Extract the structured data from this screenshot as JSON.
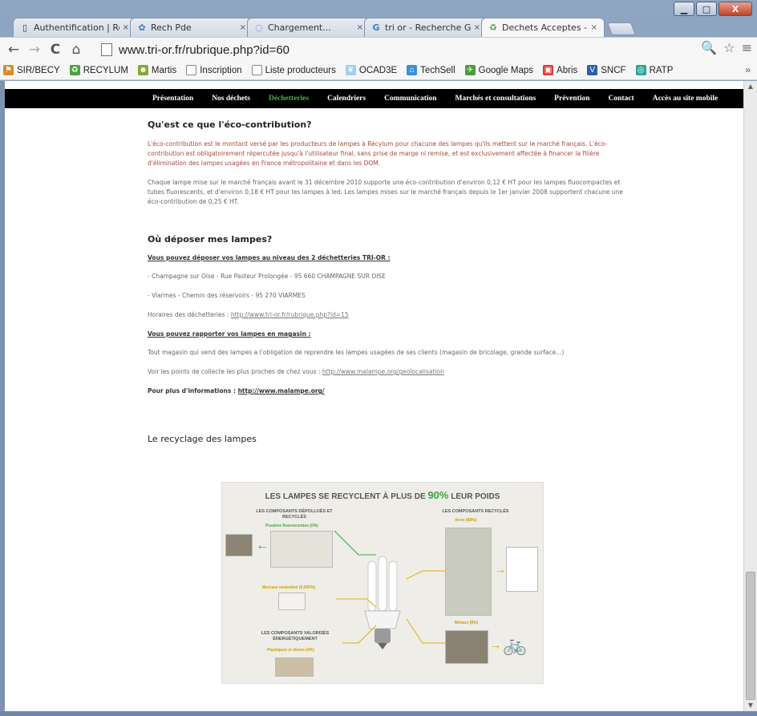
{
  "window": {
    "minimize": "▁",
    "maximize": "□",
    "close": "X"
  },
  "tabs": [
    {
      "label": "Authentification | Rec",
      "icon": "page-icon",
      "close": "×"
    },
    {
      "label": "Rech Pde",
      "icon": "gear-icon",
      "close": "×"
    },
    {
      "label": "Chargement...",
      "icon": "loading-icon",
      "close": "×"
    },
    {
      "label": "tri or - Recherche Go",
      "icon": "google-icon",
      "close": "×"
    },
    {
      "label": "Dechets Acceptes - T",
      "icon": "tri-or-icon",
      "close": "×"
    }
  ],
  "toolbar": {
    "back": "←",
    "forward": "→",
    "reload": "C",
    "home": "⌂",
    "url": "www.tri-or.fr/rubrique.php?id=60",
    "zoom": "🔍",
    "star": "☆",
    "menu": "≡"
  },
  "bookmarks": [
    {
      "label": "SIR/BECY",
      "icon": "flag-icon",
      "color": "#d98c2a"
    },
    {
      "label": "RECYLUM",
      "icon": "recycle-icon",
      "color": "#4aa43d"
    },
    {
      "label": "Martis",
      "icon": "people-icon",
      "color": "#8aa63a"
    },
    {
      "label": "Inscription",
      "icon": "page-icon",
      "color": "#ffffff"
    },
    {
      "label": "Liste producteurs",
      "icon": "page-icon",
      "color": "#ffffff"
    },
    {
      "label": "OCAD3E",
      "icon": "leaf-icon",
      "color": "#9fd0ef"
    },
    {
      "label": "TechSell",
      "icon": "house-icon",
      "color": "#3b8fd6"
    },
    {
      "label": "Google Maps",
      "icon": "map-icon",
      "color": "#4a9d3a"
    },
    {
      "label": "Abris",
      "icon": "shelter-icon",
      "color": "#d83a3a"
    },
    {
      "label": "SNCF",
      "icon": "train-icon",
      "color": "#2c5fa8"
    },
    {
      "label": "RATP",
      "icon": "metro-icon",
      "color": "#2aa59a"
    }
  ],
  "bookmarks_more": "»",
  "sitenav": [
    "Présentation",
    "Nos déchets",
    "Déchetteries",
    "Calendriers",
    "Communication",
    "Marchés et consultations",
    "Prévention",
    "Contact",
    "Accès au site mobile"
  ],
  "sitenav_active": "Déchetteries",
  "content": {
    "h_eco": "Qu'est ce que l'éco-contribution?",
    "p_eco1": "L'éco-contribution est le montant versé par les producteurs de lampes à Récylum pour chacune des lampes qu'ils mettent sur le marché français. L'éco-contribution est obligatoirement répercutée jusqu'à l'utilisateur final, sans prise de marge ni remise, et est exclusivement affectée à financer la filière d'élimination des lampes usagées en France métropolitaine et dans les DOM.",
    "p_eco2": "Chaque lampe mise sur le marché français avant le 31 décembre 2010 supporte une éco-contribution d'environ 0,12 € HT pour les lampes fluocompactes et tubes fluorescents, et d'environ 0,18 € HT pour les lampes à led. Les lampes mises sur le marché français depuis le 1er janvier 2008 supportent chacune une éco-contribution de 0,25 € HT.",
    "h_deposer": "Où déposer mes lampes?",
    "u_dechetteries": "Vous pouvez déposer vos lampes au niveau des 2 déchetteries TRI-OR :",
    "addr1": "- Champagne sur Oise - Rue Pasteur Prolongée - 95 660 CHAMPAGNE SUR OISE",
    "addr2": "- Viarmes - Chemin des réservoirs - 95 270 VIARMES",
    "horaires_label": "Horaires des déchetteries : ",
    "horaires_link": "http://www.tri-or.fr/rubrique.php?id=15",
    "u_magasin": "Vous pouvez rapporter vos lampes en magasin :",
    "magasin_text": "Tout magasin qui vend des lampes a l'obligation de reprendre les lampes usagées de ses clients (magasin de bricolage, grande surface...)",
    "points_label": "Voir les points de collecte les plus proches de chez vous : ",
    "points_link": "http://www.malampe.org/geolocalisation",
    "plus_label": "Pour plus d'informations : ",
    "plus_link": "http://www.malampe.org/",
    "h_recyclage": "Le recyclage des lampes"
  },
  "infographic": {
    "title_pre": "LES LAMPES SE RECYCLENT À PLUS DE ",
    "title_pct": "90%",
    "title_post": " LEUR POIDS",
    "left_heading": "LES COMPOSANTS DÉPOLLUÉS ET RECYCLÉS",
    "poudres": "Poudres fluorescentes (0%)",
    "mercure": "Mercure neutralisé (0,005%)",
    "valorises": "LES COMPOSANTS VALORISÉS ÉNERGÉTIQUEMENT",
    "plastiques": "Plastiques et divers (4%)",
    "right_heading": "LES COMPOSANTS RECYCLÉS",
    "verre": "Verre (88%)",
    "metaux": "Métaux (8%)"
  }
}
